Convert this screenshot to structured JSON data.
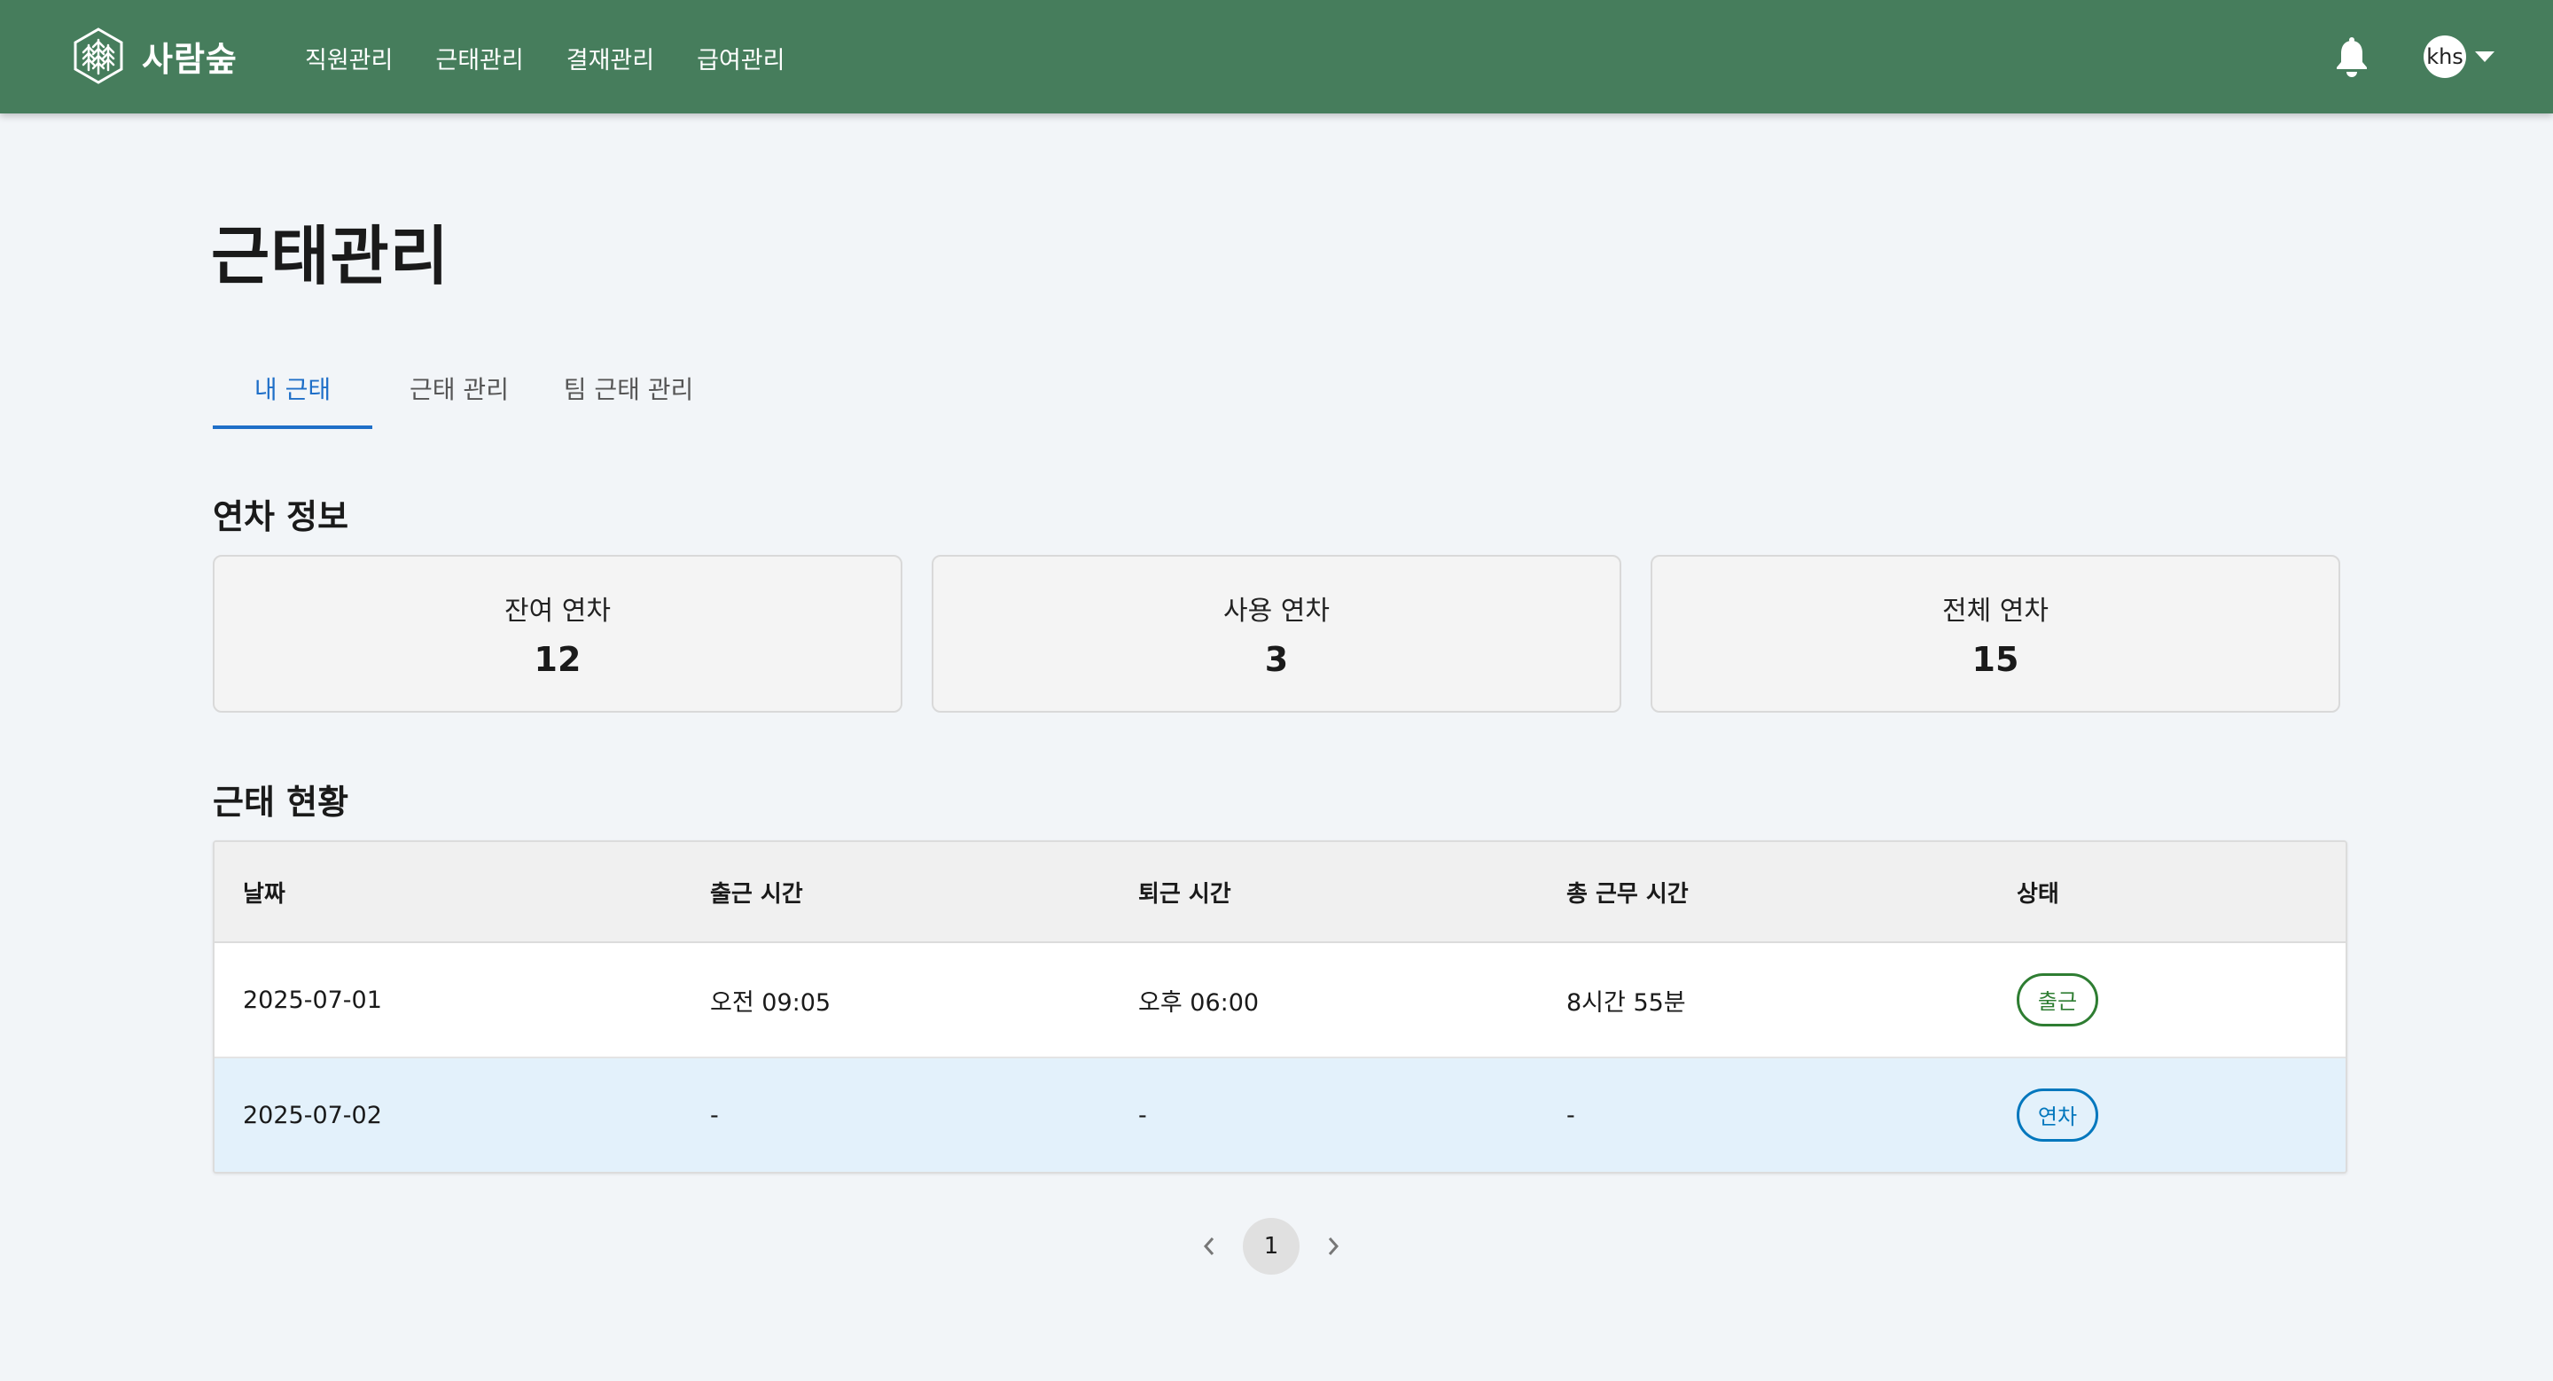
{
  "header": {
    "brand": "사람숲",
    "nav": [
      "직원관리",
      "근태관리",
      "결재관리",
      "급여관리"
    ],
    "user": "khs"
  },
  "page": {
    "title": "근태관리",
    "tabs": [
      {
        "label": "내 근태",
        "active": true
      },
      {
        "label": "근태 관리",
        "active": false
      },
      {
        "label": "팀 근태 관리",
        "active": false
      }
    ]
  },
  "leave": {
    "title": "연차 정보",
    "cards": [
      {
        "label": "잔여 연차",
        "value": "12"
      },
      {
        "label": "사용 연차",
        "value": "3"
      },
      {
        "label": "전체 연차",
        "value": "15"
      }
    ]
  },
  "attendance": {
    "title": "근태 현황",
    "columns": [
      "날짜",
      "출근 시간",
      "퇴근 시간",
      "총 근무 시간",
      "상태"
    ],
    "rows": [
      {
        "date": "2025-07-01",
        "in": "오전 09:05",
        "out": "오후 06:00",
        "total": "8시간 55분",
        "status": "출근"
      },
      {
        "date": "2025-07-02",
        "in": "-",
        "out": "-",
        "total": "-",
        "status": "연차"
      }
    ]
  },
  "pagination": {
    "current": "1"
  },
  "colors": {
    "header_bg": "#467d5c",
    "accent_blue": "#1f6fc8",
    "status_present": "#2e7d32",
    "status_leave": "#0277bd",
    "row_highlight": "#e3f1fb"
  },
  "icons": {
    "logo": "forest-hexagon-icon",
    "notification": "bell-icon",
    "menu": "caret-down-icon",
    "prev": "chevron-left-icon",
    "next": "chevron-right-icon"
  }
}
